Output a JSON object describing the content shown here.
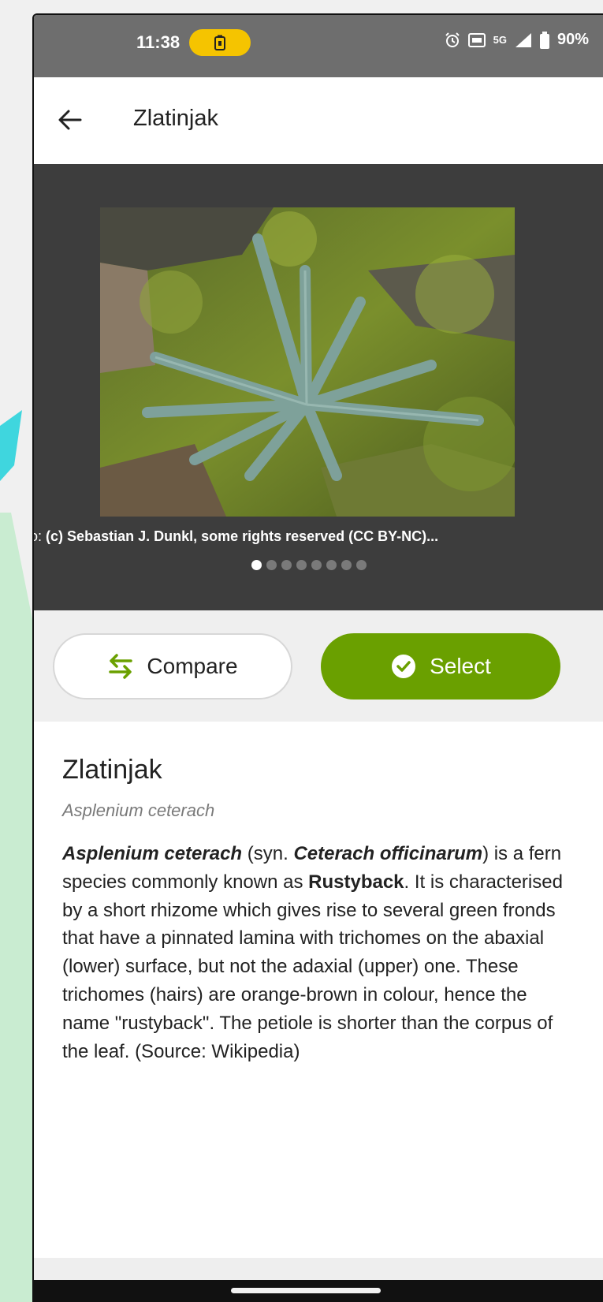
{
  "status_bar": {
    "time": "11:38",
    "battery_percent": "90%",
    "network": "5G"
  },
  "app_bar": {
    "title": "Zlatinjak"
  },
  "gallery": {
    "caption_prefix": "Photo: ",
    "caption_credit": "(c) Sebastian J. Dunkl, some rights reserved (CC BY-NC)...",
    "dot_count": 8,
    "active_index": 0
  },
  "actions": {
    "compare_label": "Compare",
    "select_label": "Select"
  },
  "species": {
    "common_name": "Zlatinjak",
    "scientific_name": "Asplenium ceterach",
    "desc_sci": "Asplenium ceterach",
    "desc_syn_open": " (syn. ",
    "desc_syn_name": "Ceterach officinarum",
    "desc_part1": ") is a fern species commonly known as ",
    "desc_common": "Rustyback",
    "desc_part2": ". It is characterised by a short rhizome which gives rise to several green fronds that have a pinnated lamina with trichomes on the abaxial (lower) surface, but not the adaxial (upper) one. These trichomes (hairs) are orange-brown in colour, hence the name \"rustyback\". The petiole is shorter than the corpus of the leaf. (Source: Wikipedia)"
  },
  "colors": {
    "accent_green": "#6aa000",
    "status_bar": "#6e6e6e",
    "gallery_bg": "#3d3d3d",
    "battery_pill": "#f5c400"
  }
}
